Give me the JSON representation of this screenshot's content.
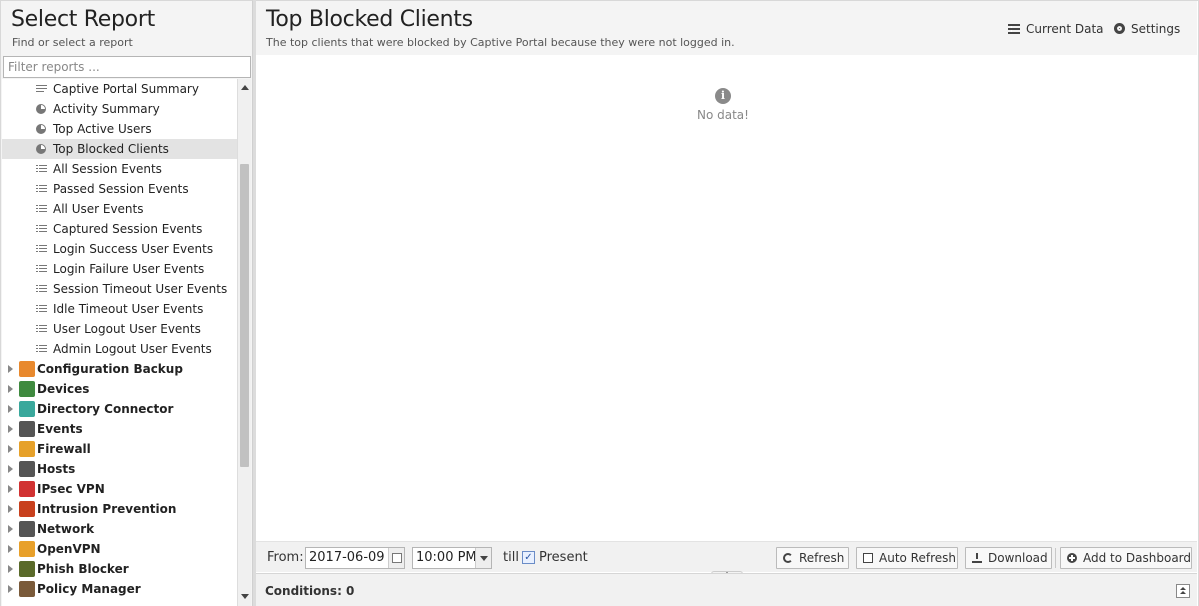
{
  "left_panel": {
    "title": "Select Report",
    "subtitle": "Find or select a report",
    "filter_placeholder": "Filter reports ...",
    "reports": [
      {
        "label": "Captive Portal Summary",
        "icon": "text-icon",
        "selected": false
      },
      {
        "label": "Activity Summary",
        "icon": "pie-chart-icon",
        "selected": false
      },
      {
        "label": "Top Active Users",
        "icon": "pie-chart-icon",
        "selected": false
      },
      {
        "label": "Top Blocked Clients",
        "icon": "pie-chart-icon",
        "selected": true
      },
      {
        "label": "All Session Events",
        "icon": "list-icon",
        "selected": false
      },
      {
        "label": "Passed Session Events",
        "icon": "list-icon",
        "selected": false
      },
      {
        "label": "All User Events",
        "icon": "list-icon",
        "selected": false
      },
      {
        "label": "Captured Session Events",
        "icon": "list-icon",
        "selected": false
      },
      {
        "label": "Login Success User Events",
        "icon": "list-icon",
        "selected": false
      },
      {
        "label": "Login Failure User Events",
        "icon": "list-icon",
        "selected": false
      },
      {
        "label": "Session Timeout User Events",
        "icon": "list-icon",
        "selected": false
      },
      {
        "label": "Idle Timeout User Events",
        "icon": "list-icon",
        "selected": false
      },
      {
        "label": "User Logout User Events",
        "icon": "list-icon",
        "selected": false
      },
      {
        "label": "Admin Logout User Events",
        "icon": "list-icon",
        "selected": false
      }
    ],
    "categories": [
      {
        "label": "Configuration Backup",
        "icon": "config-backup-icon",
        "color": "#e8892e"
      },
      {
        "label": "Devices",
        "icon": "devices-icon",
        "color": "#3f8a3f"
      },
      {
        "label": "Directory Connector",
        "icon": "directory-connector-icon",
        "color": "#3aa89c"
      },
      {
        "label": "Events",
        "icon": "events-icon",
        "color": "#555555"
      },
      {
        "label": "Firewall",
        "icon": "firewall-icon",
        "color": "#e6a12a"
      },
      {
        "label": "Hosts",
        "icon": "hosts-icon",
        "color": "#555555"
      },
      {
        "label": "IPsec VPN",
        "icon": "ipsec-vpn-icon",
        "color": "#d13232"
      },
      {
        "label": "Intrusion Prevention",
        "icon": "intrusion-prevention-icon",
        "color": "#c8401d"
      },
      {
        "label": "Network",
        "icon": "network-icon",
        "color": "#555555"
      },
      {
        "label": "OpenVPN",
        "icon": "openvpn-icon",
        "color": "#e8a02a"
      },
      {
        "label": "Phish Blocker",
        "icon": "phish-blocker-icon",
        "color": "#5a6a2a"
      },
      {
        "label": "Policy Manager",
        "icon": "policy-manager-icon",
        "color": "#7a5a3a"
      }
    ]
  },
  "header": {
    "title": "Top Blocked Clients",
    "description": "The top clients that were blocked by Captive Portal because they were not logged in.",
    "current_data_label": "Current Data",
    "settings_label": "Settings"
  },
  "content": {
    "no_data_icon": "info-icon",
    "no_data_text": "No data!"
  },
  "toolbar": {
    "from_label": "From:",
    "date_value": "2017-06-09",
    "time_value": "10:00 PM",
    "till_label": "till",
    "present_checked": true,
    "present_label": "Present",
    "refresh_label": "Refresh",
    "auto_refresh_label": "Auto Refresh",
    "download_label": "Download",
    "add_dashboard_label": "Add to Dashboard"
  },
  "conditions": {
    "label": "Conditions: 0"
  }
}
